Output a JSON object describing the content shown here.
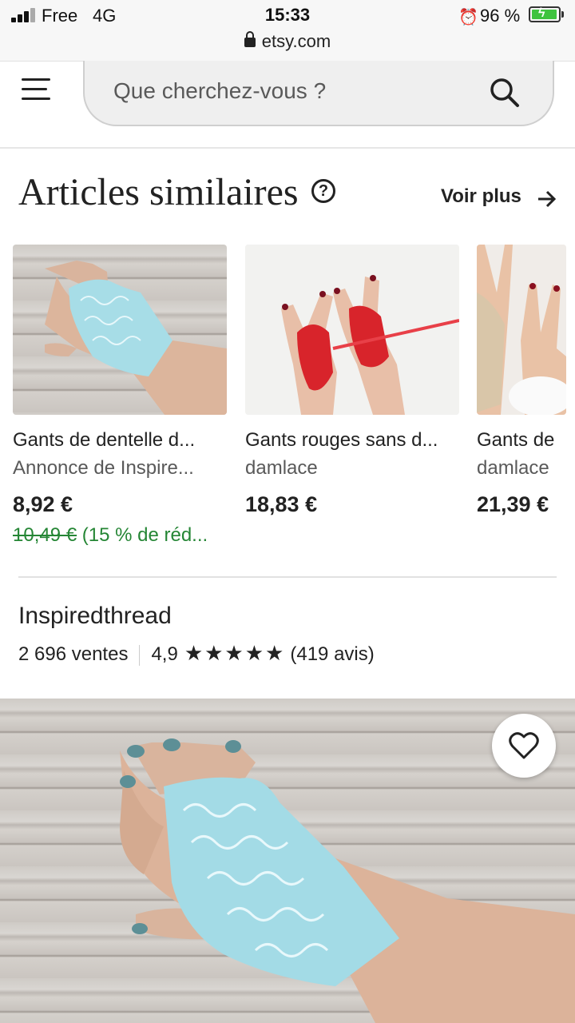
{
  "status_bar": {
    "carrier": "Free",
    "network": "4G",
    "time": "15:33",
    "url": "etsy.com",
    "battery": "96 %",
    "battery_level": 0.96
  },
  "header": {
    "search_placeholder": "Que cherchez-vous ?"
  },
  "similar": {
    "title": "Articles similaires",
    "help": "?",
    "see_more": "Voir plus",
    "items": [
      {
        "title": "Gants de dentelle d...",
        "shop": "Annonce de Inspire...",
        "price": "8,92 €",
        "old_price": "10,49 €",
        "discount": " (15 % de réd..."
      },
      {
        "title": "Gants rouges sans d...",
        "shop": "damlace",
        "price": "18,83 €"
      },
      {
        "title": "Gants de",
        "shop": "damlace",
        "price": "21,39 €"
      }
    ]
  },
  "shop": {
    "name": "Inspiredthread",
    "sales": "2 696 ventes",
    "rating": "4,9",
    "stars": "★★★★★",
    "reviews": "(419 avis)"
  },
  "colors": {
    "discount_green": "#258635",
    "text": "#222222",
    "muted": "#595959",
    "lace_blue": "#9fd8e3",
    "lace_red": "#d8242b"
  }
}
